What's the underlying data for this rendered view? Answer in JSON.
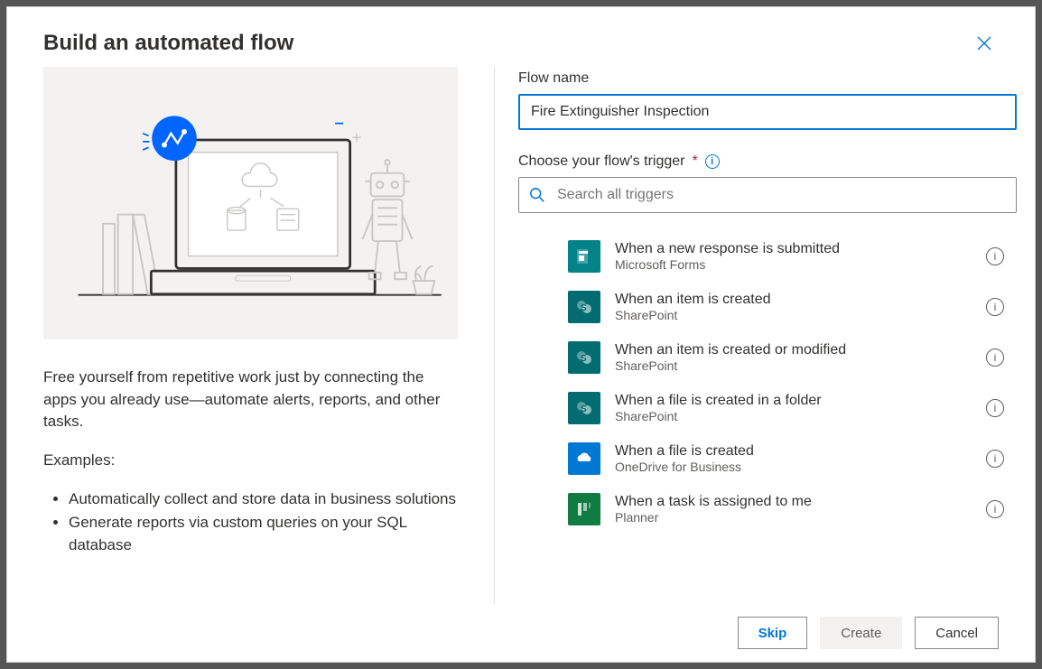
{
  "dialog": {
    "title": "Build an automated flow"
  },
  "left": {
    "description": "Free yourself from repetitive work just by connecting the apps you already use—automate alerts, reports, and other tasks.",
    "examples_label": "Examples:",
    "examples": [
      "Automatically collect and store data in business solutions",
      "Generate reports via custom queries on your SQL database"
    ]
  },
  "form": {
    "flow_name_label": "Flow name",
    "flow_name_value": "Fire Extinguisher Inspection",
    "trigger_label": "Choose your flow's trigger",
    "search_placeholder": "Search all triggers"
  },
  "triggers": [
    {
      "title": "When a new response is submitted",
      "source": "Microsoft Forms",
      "bg": "#038387",
      "glyph": "forms"
    },
    {
      "title": "When an item is created",
      "source": "SharePoint",
      "bg": "#036c70",
      "glyph": "sp"
    },
    {
      "title": "When an item is created or modified",
      "source": "SharePoint",
      "bg": "#036c70",
      "glyph": "sp"
    },
    {
      "title": "When a file is created in a folder",
      "source": "SharePoint",
      "bg": "#036c70",
      "glyph": "sp"
    },
    {
      "title": "When a file is created",
      "source": "OneDrive for Business",
      "bg": "#0078d4",
      "glyph": "od"
    },
    {
      "title": "When a task is assigned to me",
      "source": "Planner",
      "bg": "#107c41",
      "glyph": "pl"
    }
  ],
  "footer": {
    "skip": "Skip",
    "create": "Create",
    "cancel": "Cancel"
  }
}
